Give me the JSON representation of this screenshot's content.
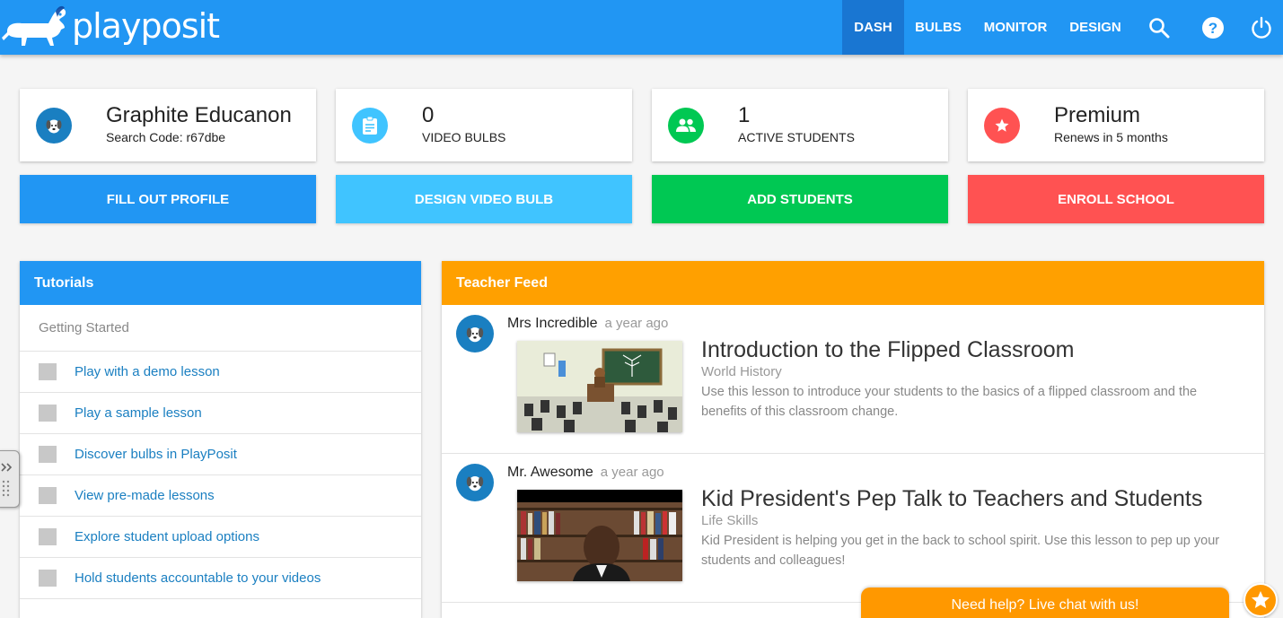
{
  "brand": {
    "name": "playposit"
  },
  "nav": {
    "items": [
      {
        "label": "DASH",
        "active": true
      },
      {
        "label": "BULBS"
      },
      {
        "label": "MONITOR"
      },
      {
        "label": "DESIGN"
      }
    ],
    "icons": [
      "search-icon",
      "help-icon",
      "power-icon"
    ]
  },
  "stats": [
    {
      "big": "Graphite Educanon",
      "small": "Search Code: r67dbe",
      "icon": "dog-avatar-icon",
      "color": "#1a7fc1"
    },
    {
      "big": "0",
      "small": "VIDEO BULBS",
      "icon": "clipboard-icon",
      "color": "#40c4ff"
    },
    {
      "big": "1",
      "small": "ACTIVE STUDENTS",
      "icon": "group-icon",
      "color": "#00c853"
    },
    {
      "big": "Premium",
      "small": "Renews in 5 months",
      "icon": "star-icon",
      "color": "#ff5252"
    }
  ],
  "actions": [
    {
      "label": "FILL OUT PROFILE",
      "color": "#2196f3"
    },
    {
      "label": "DESIGN VIDEO BULB",
      "color": "#40c4ff"
    },
    {
      "label": "ADD STUDENTS",
      "color": "#00c853"
    },
    {
      "label": "ENROLL SCHOOL",
      "color": "#ff5252"
    }
  ],
  "tutorials": {
    "title": "Tutorials",
    "section": "Getting Started",
    "items": [
      "Play with a demo lesson",
      "Play a sample lesson",
      "Discover bulbs in PlayPosit",
      "View pre-made lessons",
      "Explore student upload options",
      "Hold students accountable to your videos"
    ]
  },
  "feed": {
    "title": "Teacher Feed",
    "items": [
      {
        "author": "Mrs Incredible",
        "time": "a year ago",
        "title": "Introduction to the Flipped Classroom",
        "subject": "World History",
        "description": "Use this lesson to introduce your students to the basics of a flipped classroom and the benefits of this classroom change."
      },
      {
        "author": "Mr. Awesome",
        "time": "a year ago",
        "title": "Kid President's Pep Talk to Teachers and Students",
        "subject": "Life Skills",
        "description": "Kid President is helping you get in the back to school spirit. Use this lesson to pep up your students and colleagues!"
      }
    ]
  },
  "chat": {
    "label": "Need help? Live chat with us!"
  },
  "colors": {
    "primary": "#2196f3",
    "primary_dark": "#1976d2",
    "feed_header": "#ffa000",
    "link": "#1a7fc1",
    "chat": "#ff9800"
  }
}
